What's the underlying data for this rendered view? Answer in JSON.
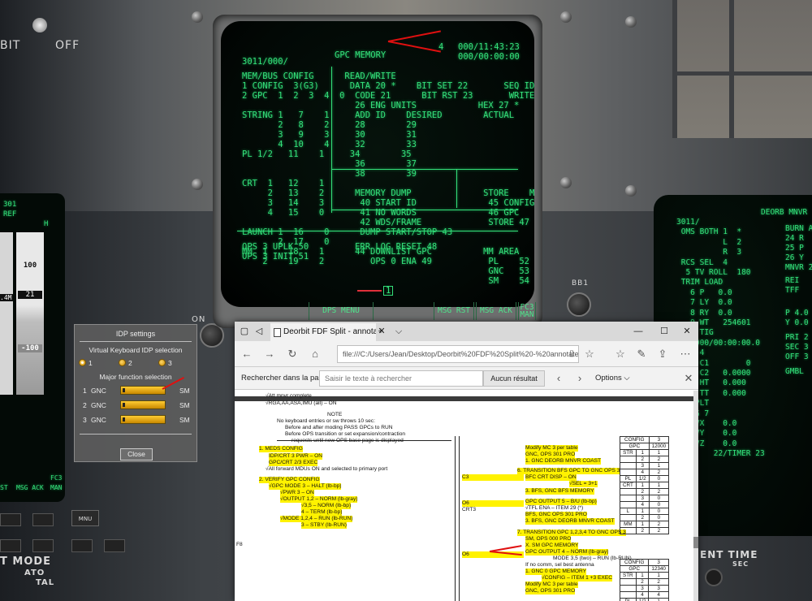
{
  "cockpit": {
    "off_label_left": "BIT",
    "off_label_right": "OFF",
    "on_label": "ON",
    "bottom_left_mode": "T MODE",
    "bottom_left_ato": "ATO",
    "bottom_left_tal": "TAL",
    "bottom_right_time": "ENT TIME",
    "bottom_right_sec": "SEC",
    "mnu_label": "MNU",
    "bb1": "BB1"
  },
  "crt_main": {
    "header_left": "3011/000/",
    "header_title": "GPC MEMORY",
    "header_count": "4",
    "header_time1": "000/11:43:23",
    "header_time2": "000/00:00:00",
    "lines": [
      "MEM/BUS CONFIG      READ/WRITE",
      "1 CONFIG  3(G3)      DATA 20 *    BIT SET 22       SEQ ID 24",
      "2 GPC  1  2  3  4  0  CODE 21      BIT RST 23       WRITE  25",
      "                      26 ENG UNITS            HEX 27 *",
      "STRING 1   7    1     ADD ID    DESIRED        ACTUAL",
      "       2   8    2     28        29",
      "       3   9    3     30        31",
      "       4  10    4     32        33",
      "PL 1/2   11    1     34        35",
      "                      36        37",
      "                      38        39",
      "CRT  1   12    1",
      "     2   13    2      MEMORY DUMP              STORE    MC=",
      "     3   14    3       40 START ID              45 CONFIG",
      "     4   15    0       41 NO WORDS              46 GPC",
      "                       42 WDS/FRAME             STORE 47",
      "LAUNCH 1  16    0      DUMP START/STOP 43",
      "       2  17    0",
      "MM  1    18    1      44 DOWNLIST GPC          MM AREA",
      "    2    19    2         OPS 0 ENA 49           PL    52   1",
      "                                                GNC   53   1",
      "                                                SM    54   1",
      "OPS 3 UPLK 50         ERR LOG RESET 48",
      "OPS 3 INIT 51"
    ],
    "page_marker": "1",
    "softkeys": [
      "DPS MENU",
      "MSG RST",
      "MSG ACK",
      "FC3 MAN"
    ]
  },
  "crt_left": {
    "lines": [
      "301",
      "REF",
      "H"
    ],
    "values": [
      "100",
      "21",
      ".4M",
      "-100"
    ],
    "softkeys": [
      "ST",
      "MSG ACK",
      "FC3 MAN"
    ]
  },
  "crt_right": {
    "title": "DEORB MNVR",
    "lines": [
      "3011/",
      " OMS BOTH 1  *",
      "          L  2",
      "          R  3",
      " RCS SEL  4",
      "  5 TV ROLL  180",
      " TRIM LOAD",
      "   6 P   0.0",
      "   7 LY  0.0",
      "   8 RY  0.0",
      "   9 WT   254601",
      "  10 TIG",
      "    000/00:00:00.0",
      "  EG 4",
      "     C1        0",
      "     C2   0.0000",
      "     HT   0.000",
      "     TT   0.000",
      "  PRPLT",
      "  PEG 7",
      "   DVX    0.0",
      "   DVY    0.0",
      "   DVZ    0.0",
      "        22/TIMER 23"
    ],
    "right_col": [
      "BURN A",
      "24 R",
      "25 P",
      "26 Y",
      "MNVR 2",
      "REI",
      "TFF",
      "P 4.0",
      "Y 0.0",
      "PRI 2",
      "SEC 3",
      "OFF 3",
      "GMBL"
    ]
  },
  "idp": {
    "title": "IDP settings",
    "keyboard_label": "Virtual Keyboard IDP selection",
    "radios": [
      "1",
      "2",
      "3"
    ],
    "major_label": "Major function selection",
    "rows": [
      {
        "num": "1",
        "left": "GNC",
        "right": "SM"
      },
      {
        "num": "2",
        "left": "GNC",
        "right": "SM"
      },
      {
        "num": "3",
        "left": "GNC",
        "right": "SM"
      }
    ],
    "close_label": "Close"
  },
  "browser": {
    "tab_title": "Deorbit FDF Split - annotate",
    "tab_close": "✕",
    "new_tab": "+",
    "tab_menu": "⌵",
    "win_min": "—",
    "win_max": "☐",
    "win_close": "✕",
    "url": "file:///C:/Users/Jean/Desktop/Deorbit%20FDF%20Split%20-%20annotate",
    "find_label": "Rechercher dans la page",
    "find_placeholder": "Saisir le texte à rechercher",
    "find_result": "Aucun résultat",
    "find_options": "Options",
    "find_close": "✕"
  },
  "doc": {
    "left_col": [
      {
        "t": "CONFIG   12",
        "hl": true
      },
      {
        "t": "• If IMU or RHC dilemma, do not proceed with OPS 3 transition  •",
        "hl": false
      },
      {
        "t": "√Att mnvr complete",
        "hl": false
      },
      {
        "t": "√RGA,AA,ASA,IMU (all) – ON",
        "hl": false
      },
      {
        "t": "NOTE",
        "hl": false
      },
      {
        "t": "No keyboard entries or sw throws 10 sec:",
        "hl": false
      },
      {
        "t": "Before and after moding PASS GPCs to RUN",
        "hl": false
      },
      {
        "t": "Before OPS transition or set expansion/contraction",
        "hl": false
      },
      {
        "t": "requests until new OPS base page is displayed",
        "hl": false
      },
      {
        "t": "1.   MEDS CONFIG",
        "hl": true
      },
      {
        "t": "IDP/CRT 3 PWR – ON",
        "hl": true
      },
      {
        "t": "GPC/CRT 2/3 EXEC",
        "hl": true
      },
      {
        "t": "√All forward MDUs ON and selected to primary port",
        "hl": false
      },
      {
        "t": "2.   VERIFY GPC CONFIG",
        "hl": true
      },
      {
        "t": "√GPC MODE 3 – HALT (lb-bp)",
        "hl": true
      },
      {
        "t": "√PWR 3 – ON",
        "hl": true
      },
      {
        "t": "√OUTPUT 1,2 – NORM (lb-gray)",
        "hl": true
      },
      {
        "t": "√3,5 – NORM (lb-bp)",
        "hl": true
      },
      {
        "t": "4 – TERM (lb-bp)",
        "hl": true
      },
      {
        "t": "√MODE 1,2,4 – RUN (lb-RUN)",
        "hl": true
      },
      {
        "t": "3 – STBY (lb-RUN)",
        "hl": true
      }
    ],
    "f8": "F8",
    "right_col": [
      {
        "t": "Modify MC 3 per table",
        "hl": true
      },
      {
        "t": "GNC, OPS 301 PRO",
        "hl": true
      },
      {
        "t": "1.  GNC DEORB MNVR COAST",
        "hl": true
      },
      {
        "t": "6.  TRANSITION BFS GPC TO GNC OPS 3",
        "hl": true
      },
      {
        "t": "BFC CRT DISP – ON",
        "hl": true
      },
      {
        "t": "√SEL = 3+1",
        "hl": true
      },
      {
        "t": "3.  BFS, GNC BFS MEMORY",
        "hl": true
      },
      {
        "t": "GPC OUTPUT 5 – B/U (lb-bp)",
        "hl": true
      },
      {
        "t": "√TFL ENA – ITEM 29 (*)",
        "hl": false
      },
      {
        "t": "BFS, GNC OPS 301 PRO",
        "hl": true
      },
      {
        "t": "3.  BFS, GNC DEORB MNVR COAST",
        "hl": true
      },
      {
        "t": "7.  TRANSITION GPC 1,2,3,4 TO GNC OPS 3",
        "hl": true
      },
      {
        "t": "SM, OPS 000 PRO",
        "hl": true
      },
      {
        "t": "X.  SM GPC MEMORY",
        "hl": true
      },
      {
        "t": "GPC OUTPUT 4 – NORM (lb-gray)",
        "hl": true
      },
      {
        "t": "MODE 3,5 (two) – RUN (lb-RUN)",
        "hl": false
      },
      {
        "t": "If no comm, sel best antenna",
        "hl": false
      },
      {
        "t": "1.  GNC 0 GPC MEMORY",
        "hl": true
      },
      {
        "t": "√CONFIG – ITEM 1 +3 EXEC",
        "hl": true
      },
      {
        "t": "Modify MC 3 per table",
        "hl": true
      },
      {
        "t": "GNC, OPS 301 PRO",
        "hl": true
      }
    ],
    "margin_labels": [
      "C3",
      "O6",
      "CRT3",
      "O6"
    ],
    "table1": {
      "header": [
        [
          "CONFIG",
          "3"
        ],
        [
          "GPC",
          "12000"
        ]
      ],
      "rows": [
        [
          "STR",
          "1",
          "1"
        ],
        [
          "",
          "2",
          "2"
        ],
        [
          "",
          "3",
          "1"
        ],
        [
          "",
          "4",
          "2"
        ],
        [
          "PL",
          "1/2",
          "0"
        ],
        [
          "CRT",
          "1",
          "1"
        ],
        [
          "",
          "2",
          "2"
        ],
        [
          "",
          "3",
          "0"
        ],
        [
          "",
          "4",
          "0"
        ],
        [
          "L",
          "1",
          "0"
        ],
        [
          "",
          "2",
          "0"
        ],
        [
          "MM",
          "1",
          "2"
        ],
        [
          "",
          "2",
          "2"
        ]
      ]
    },
    "table2": {
      "header": [
        [
          "CONFIG",
          "3"
        ],
        [
          "GPC",
          "12340"
        ]
      ],
      "rows": [
        [
          "STR",
          "1",
          "1"
        ],
        [
          "",
          "2",
          "2"
        ],
        [
          "",
          "3",
          "3"
        ],
        [
          "",
          "4",
          "4"
        ],
        [
          "PL",
          "1/2",
          "1"
        ]
      ]
    }
  }
}
